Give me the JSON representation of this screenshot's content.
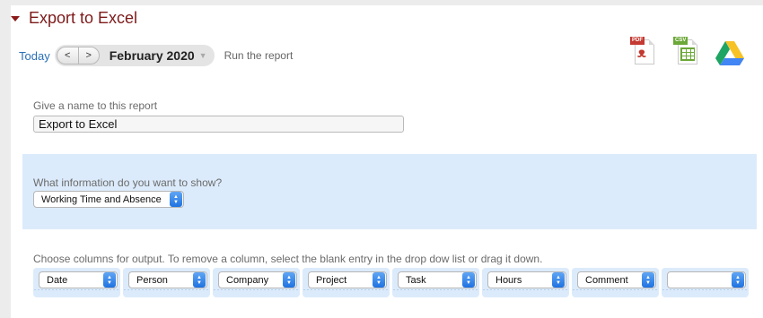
{
  "header": {
    "title": "Export to Excel"
  },
  "datebar": {
    "today_label": "Today",
    "prev_glyph": "<",
    "next_glyph": ">",
    "month": "February 2020",
    "run_label": "Run the report"
  },
  "export": {
    "pdf_tag": "PDF",
    "csv_tag": "CSV"
  },
  "name_section": {
    "label": "Give a name to this report",
    "value": "Export to Excel"
  },
  "info_section": {
    "label": "What information do you want to show?",
    "selected": "Working Time and Absence"
  },
  "columns_section": {
    "label": "Choose columns for output. To remove a column, select the blank entry in the drop dow list or drag it down.",
    "columns": [
      "Date",
      "Person",
      "Company",
      "Project",
      "Task",
      "Hours",
      "Comment",
      ""
    ]
  },
  "colors": {
    "title": "#7d1a1a",
    "link": "#2a6fb5",
    "band": "#dcebfb",
    "chevron": "#1f72e0"
  }
}
